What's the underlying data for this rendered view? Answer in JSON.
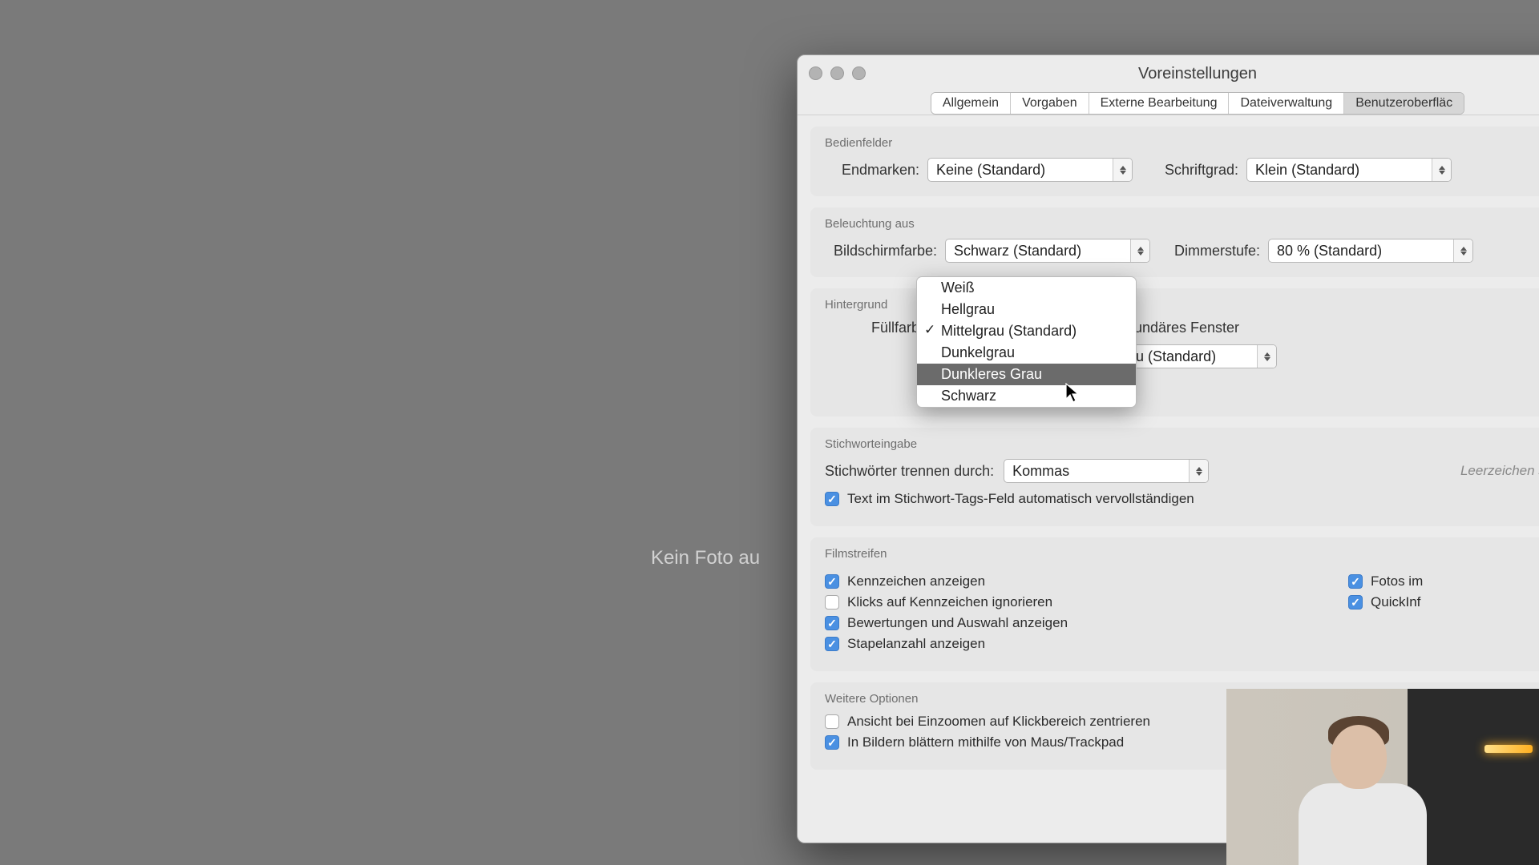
{
  "bg_text": "Kein Foto au",
  "window": {
    "title": "Voreinstellungen"
  },
  "tabs": [
    "Allgemein",
    "Vorgaben",
    "Externe Bearbeitung",
    "Dateiverwaltung",
    "Benutzeroberfläc"
  ],
  "sections": {
    "bedien": {
      "title": "Bedienfelder",
      "endmarken_label": "Endmarken:",
      "endmarken_value": "Keine (Standard)",
      "schrift_label": "Schriftgrad:",
      "schrift_value": "Klein (Standard)"
    },
    "beleucht": {
      "title": "Beleuchtung aus",
      "bild_label": "Bildschirmfarbe:",
      "bild_value": "Schwarz (Standard)",
      "dimmer_label": "Dimmerstufe:",
      "dimmer_value": "80 % (Standard)"
    },
    "hinter": {
      "title": "Hintergrund",
      "fuell_label": "Füllfarbe",
      "sek_label": "Sekundäres Fenster",
      "sek_value": "Mittelgrau (Standard)"
    },
    "stich": {
      "title": "Stichworteingabe",
      "trennen_label": "Stichwörter trennen durch:",
      "trennen_value": "Kommas",
      "hint": "Leerzeichen sind i",
      "autocomplete": "Text im Stichwort-Tags-Feld automatisch vervollständigen"
    },
    "film": {
      "title": "Filmstreifen",
      "c1": "Kennzeichen anzeigen",
      "c2": "Klicks auf Kennzeichen ignorieren",
      "c3": "Bewertungen und Auswahl anzeigen",
      "c4": "Stapelanzahl anzeigen",
      "c5": "Fotos im",
      "c6": "QuickInf"
    },
    "weitere": {
      "title": "Weitere Optionen",
      "c1": "Ansicht bei Einzoomen auf Klickbereich zentrieren",
      "c2": "In Bildern blättern mithilfe von Maus/Trackpad"
    }
  },
  "menu": {
    "items": [
      "Weiß",
      "Hellgrau",
      "Mittelgrau (Standard)",
      "Dunkelgrau",
      "Dunkleres Grau",
      "Schwarz"
    ],
    "selected_index": 2,
    "highlighted_index": 4
  }
}
